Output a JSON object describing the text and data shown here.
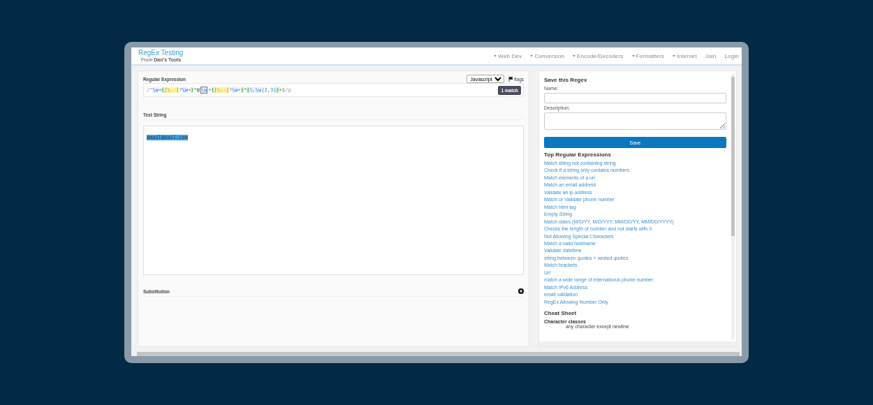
{
  "header": {
    "title": "RegEx Testing",
    "subtitle_prefix": "From",
    "subtitle_brand": "Dan's Tools"
  },
  "nav": [
    {
      "label": "Web Dev",
      "dropdown": true
    },
    {
      "label": "Conversion",
      "dropdown": true
    },
    {
      "label": "Encode/Decoders",
      "dropdown": true
    },
    {
      "label": "Formatters",
      "dropdown": true
    },
    {
      "label": "Internet",
      "dropdown": true
    },
    {
      "label": "Join",
      "dropdown": false
    },
    {
      "label": "Login",
      "dropdown": false
    }
  ],
  "regex": {
    "label": "Regular Expression",
    "flavor": "Javascript",
    "flags_label": "flags",
    "match_badge": "1 match",
    "tokens": [
      {
        "text": "/",
        "kind": "delim",
        "highlighted": false
      },
      {
        "text": "^",
        "kind": "anchor",
        "highlighted": false
      },
      {
        "text": "\\w",
        "kind": "escape",
        "highlighted": false
      },
      {
        "text": "+",
        "kind": "quant",
        "highlighted": false
      },
      {
        "text": "(",
        "kind": "group",
        "highlighted": false
      },
      {
        "text": "[\\.-]",
        "kind": "set",
        "highlighted": false
      },
      {
        "text": "?",
        "kind": "quant",
        "highlighted": false
      },
      {
        "text": "\\w",
        "kind": "escape",
        "highlighted": false
      },
      {
        "text": "+",
        "kind": "quant",
        "highlighted": false
      },
      {
        "text": ")",
        "kind": "group",
        "highlighted": false
      },
      {
        "text": "*",
        "kind": "quant",
        "highlighted": false
      },
      {
        "text": "@",
        "kind": "literal",
        "highlighted": false
      },
      {
        "text": "\\w",
        "kind": "escape",
        "highlighted": true
      },
      {
        "text": "+",
        "kind": "quant",
        "highlighted": false
      },
      {
        "text": "(",
        "kind": "group",
        "highlighted": false
      },
      {
        "text": "[\\.-]",
        "kind": "set",
        "highlighted": false
      },
      {
        "text": "?",
        "kind": "quant",
        "highlighted": false
      },
      {
        "text": "\\w",
        "kind": "escape",
        "highlighted": false
      },
      {
        "text": "+",
        "kind": "quant",
        "highlighted": false
      },
      {
        "text": ")",
        "kind": "group",
        "highlighted": false
      },
      {
        "text": "*",
        "kind": "quant",
        "highlighted": false
      },
      {
        "text": "(",
        "kind": "group",
        "highlighted": false
      },
      {
        "text": "\\.",
        "kind": "escape",
        "highlighted": false
      },
      {
        "text": "\\w",
        "kind": "escape",
        "highlighted": false
      },
      {
        "text": "{2,3}",
        "kind": "quant",
        "highlighted": false
      },
      {
        "text": ")",
        "kind": "group",
        "highlighted": false
      },
      {
        "text": "+",
        "kind": "quant",
        "highlighted": false
      },
      {
        "text": "$",
        "kind": "anchor",
        "highlighted": false
      },
      {
        "text": "/",
        "kind": "delim",
        "highlighted": false
      },
      {
        "text": "g",
        "kind": "flags",
        "highlighted": false
      }
    ]
  },
  "test_string": {
    "label": "Test String",
    "value": "email@mail.com",
    "matched": true
  },
  "substitution": {
    "label": "Substitution",
    "expanded": false
  },
  "save_form": {
    "title": "Save this Regex",
    "name_label": "Name:",
    "description_label": "Description:",
    "button": "Save"
  },
  "top_expressions": {
    "title": "Top Regular Expressions",
    "items": [
      "Match string not containing string",
      "Check if a string only contains numbers",
      "Match elements of a url",
      "Match an email address",
      "Validate an ip address",
      "Match or Validate phone number",
      "Match html tag",
      "Empty String",
      "Match dates (M/D/YY, M/D/YYY, MM/DD/YY, MM/DD/YYYY)",
      "Checks the length of number and not starts with 0",
      "Not Allowing Special Characters",
      "Match a valid hostname",
      "Validate datetime",
      "string between quotes + nested quotes",
      "Match brackets",
      "Url",
      "match a wide range of international phone number",
      "Match IPv6 Address",
      "email validation",
      "RegEx Allowing Number Only"
    ]
  },
  "cheat_sheet": {
    "title": "Cheat Sheet",
    "section": "Character classes",
    "first_entry": "any character except newline"
  }
}
